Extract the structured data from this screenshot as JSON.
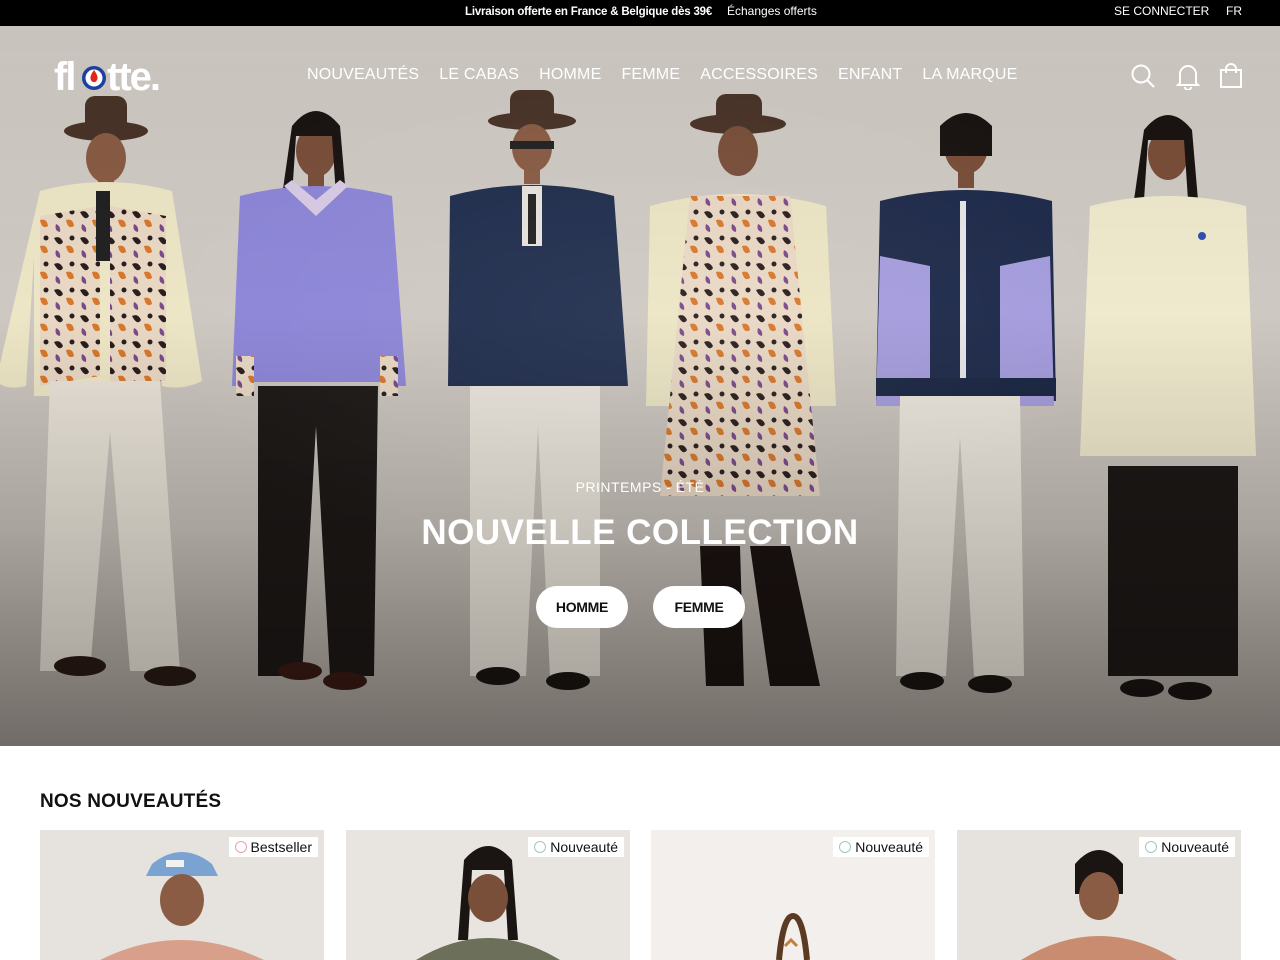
{
  "topbar": {
    "promo": "Livraison offerte en France & Belgique dès 39€",
    "promo2": "Échanges offerts",
    "login": "SE CONNECTER",
    "lang": "FR"
  },
  "header": {
    "logo": "flotte.",
    "nav": [
      "NOUVEAUTÉS",
      "LE CABAS",
      "HOMME",
      "FEMME",
      "ACCESSOIRES",
      "ENFANT",
      "LA MARQUE"
    ],
    "icons": [
      "search-icon",
      "bell-icon",
      "bag-icon"
    ]
  },
  "hero": {
    "eyebrow": "PRINTEMPS - ÉTÉ",
    "headline": "NOUVELLE COLLECTION",
    "buttons": [
      "HOMME",
      "FEMME"
    ]
  },
  "section": {
    "title": "NOS NOUVEAUTÉS"
  },
  "products": [
    {
      "badge": "Bestseller",
      "badge_color": "#e8a0a8"
    },
    {
      "badge": "Nouveauté",
      "badge_color": "#9fc8c2"
    },
    {
      "badge": "Nouveauté",
      "badge_color": "#9fc8c2"
    },
    {
      "badge": "Nouveauté",
      "badge_color": "#9fc8c2"
    }
  ],
  "colors": {
    "topbar_bg": "#000000",
    "logo_red": "#e1251b",
    "logo_blue": "#1d3fa0",
    "button_bg": "#ffffff"
  }
}
